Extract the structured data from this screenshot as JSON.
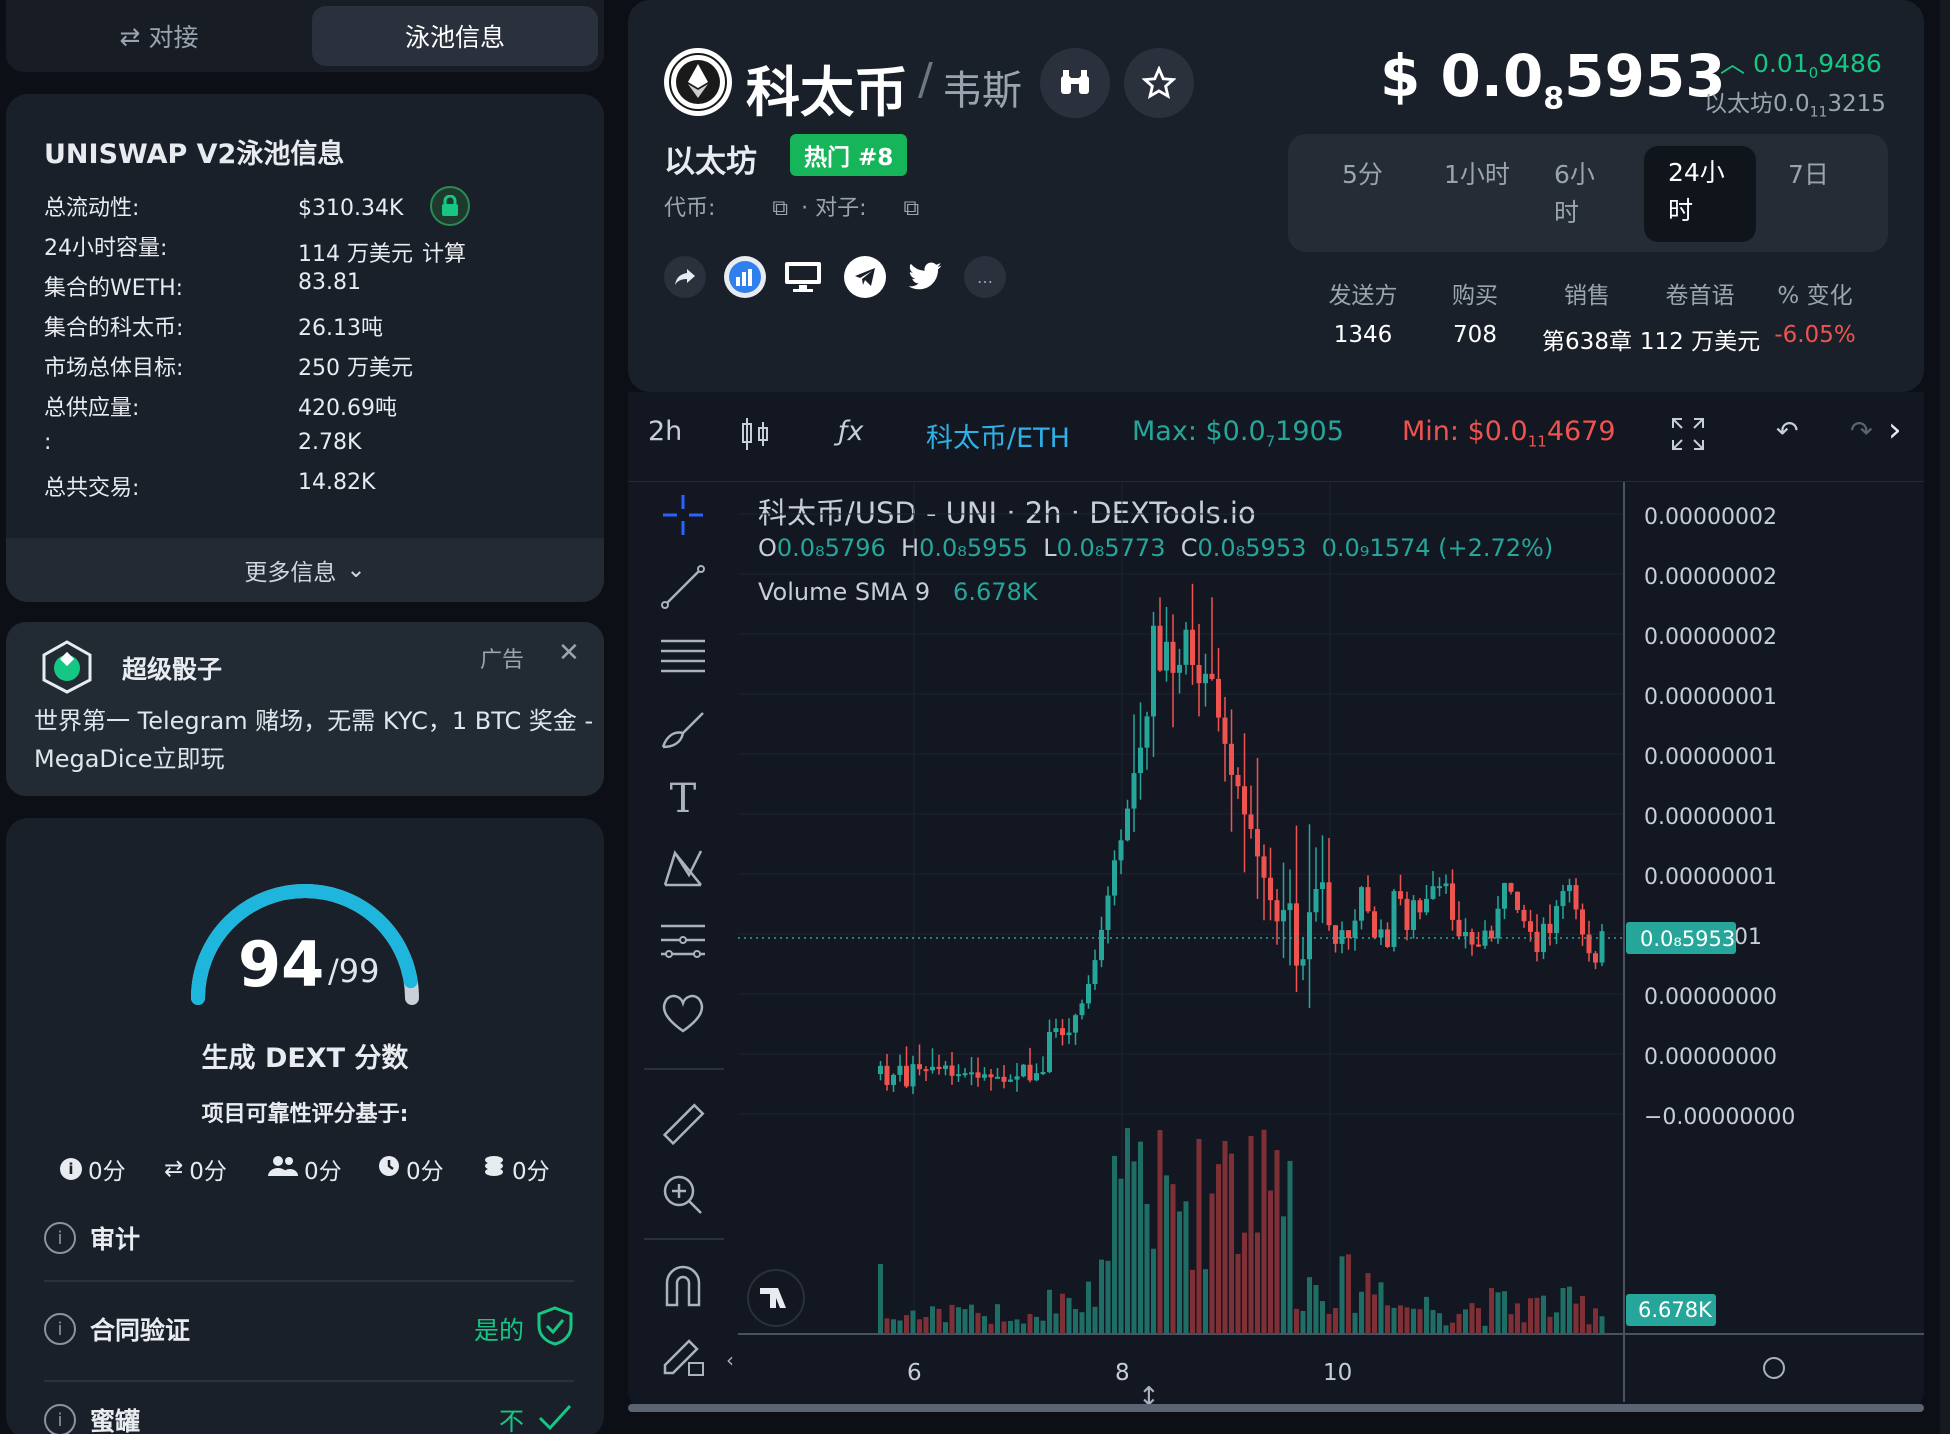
{
  "tabs": {
    "swap": "对接",
    "pool": "泳池信息"
  },
  "pool": {
    "title": "UNISWAP V2泳池信息",
    "rows": [
      {
        "label": "总流动性:",
        "value": "$310.34K"
      },
      {
        "label": "24小时容量:",
        "value": "114 万美元",
        "extra": "计算"
      },
      {
        "label": "集合的WETH:",
        "value": "83.81"
      },
      {
        "label": "集合的科太币:",
        "value": "26.13吨"
      },
      {
        "label": "市场总体目标:",
        "value": "250 万美元"
      },
      {
        "label": "总供应量:",
        "value": "420.69吨"
      },
      {
        "label": ":",
        "value": "2.78K"
      },
      {
        "label": "总共交易:",
        "value": "14.82K"
      }
    ],
    "more": "更多信息"
  },
  "ad": {
    "title": "超级骰子",
    "label": "广告",
    "close": "✕",
    "text": "世界第一 Telegram 赌场，无需 KYC，1 BTC 奖金 - MegaDice立即玩"
  },
  "score": {
    "value": "94",
    "max": "/99",
    "fraction": 0.949,
    "label": "生成 DEXT 分数",
    "basis": "项目可靠性评分基于:",
    "subscores": [
      "0分",
      "0分",
      "0分",
      "0分",
      "0分"
    ],
    "checks": [
      {
        "label": "审计",
        "value": ""
      },
      {
        "label": "合同验证",
        "value": "是的"
      },
      {
        "label": "蜜罐",
        "value": "不"
      }
    ],
    "colors": {
      "arc": "#1fb6dd",
      "track": "#c9d0d8",
      "ok": "#16c784"
    }
  },
  "coin": {
    "name": "科太币",
    "slash": "/",
    "alt": "韦斯",
    "logo_text": "科太币",
    "chain": "以太坊",
    "hot": "热门 #8",
    "token_label": "代币:",
    "pair_label": "· 对子:",
    "price_prefix": "$ 0.0",
    "price_sub": "8",
    "price_tail": "5953",
    "change": "0.01",
    "change_sub": "0",
    "change_tail": "9486",
    "eth_price_prefix": "以太坊0.0",
    "eth_price_sub": "11",
    "eth_price_tail": "3215"
  },
  "timeframes": [
    "5分",
    "1小时",
    "6小时",
    "24小时",
    "7日"
  ],
  "stats": [
    {
      "label": "发送方",
      "value": "1346"
    },
    {
      "label": "购买",
      "value": "708"
    },
    {
      "label": "销售",
      "value": "第638章"
    },
    {
      "label": "卷首语",
      "value": "112 万美元"
    },
    {
      "label": "% 变化",
      "value": "-6.05%"
    }
  ],
  "chart_toolbar": {
    "interval": "2h",
    "pair": "科太币/ETH",
    "max": "Max: $0.07 1905",
    "max_prefix": "Max: $0.0",
    "max_sub": "7",
    "max_tail": "1905",
    "min_prefix": "Min: $0.0",
    "min_sub": "11",
    "min_tail": "4679"
  },
  "legend": {
    "title": "科太币/USD - UNI · 2h · DEXTools.io",
    "o_label": "O",
    "o": "0.0₈5796",
    "h_label": "H",
    "h": "0.0₈5955",
    "l_label": "L",
    "l": "0.0₈5773",
    "c_label": "C",
    "c": "0.0₈5953",
    "chg": "0.0₉1574 (+2.72%)",
    "vol_label": "Volume SMA 9",
    "vol": "6.678K"
  },
  "chart_data": {
    "type": "candlestick",
    "x_ticks": [
      "6",
      "8",
      "10"
    ],
    "y_ticks": [
      "0.00000002",
      "0.00000002",
      "0.00000002",
      "0.00000001",
      "0.00000001",
      "0.00000001",
      "0.00000001",
      "01",
      "0.00000000",
      "0.00000000",
      "−0.00000000"
    ],
    "last_price_label": "0.0₈5953",
    "volume_label": "6.678K",
    "colors": {
      "up": "#26a69a",
      "down": "#ef5350",
      "vol_up": "#1f6e66",
      "vol_down": "#7f2f36"
    }
  }
}
